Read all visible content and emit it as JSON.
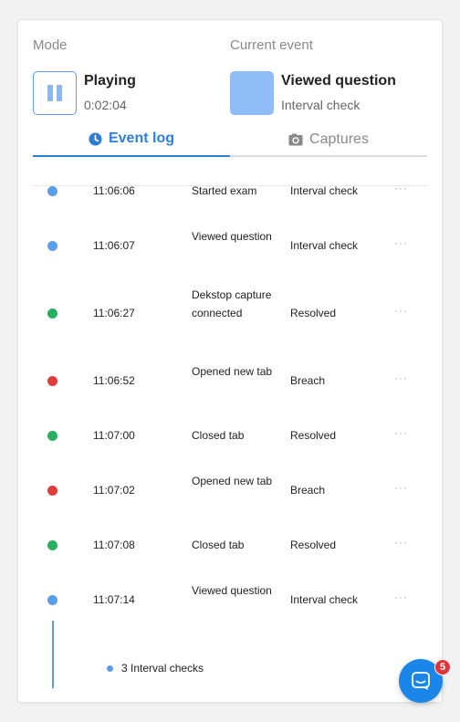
{
  "mode": {
    "label": "Mode",
    "state": "Playing",
    "elapsed": "0:02:04"
  },
  "current_event": {
    "label": "Current event",
    "title": "Viewed question",
    "subtitle": "Interval check",
    "swatch_color": "#8fbcf7"
  },
  "tabs": [
    {
      "label": "Event log",
      "icon": "clock-icon",
      "active": true
    },
    {
      "label": "Captures",
      "icon": "camera-icon",
      "active": false
    }
  ],
  "status_colors": {
    "blue": "#5b9ee9",
    "green": "#27ae60",
    "red": "#e03c3c"
  },
  "events": [
    {
      "time": "11:06:06",
      "description": "Started exam",
      "status": "Interval check",
      "color": "blue",
      "more": "···"
    },
    {
      "time": "11:06:07",
      "description": "Viewed question",
      "status": "Interval check",
      "color": "blue",
      "more": "···"
    },
    {
      "time": "11:06:27",
      "description": "Dekstop capture connected",
      "status": "Resolved",
      "color": "green",
      "more": "···"
    },
    {
      "time": "11:06:52",
      "description": "Opened new tab",
      "status": "Breach",
      "color": "red",
      "more": "···"
    },
    {
      "time": "11:07:00",
      "description": "Closed tab",
      "status": "Resolved",
      "color": "green",
      "more": "···"
    },
    {
      "time": "11:07:02",
      "description": "Opened new tab",
      "status": "Breach",
      "color": "red",
      "more": "···"
    },
    {
      "time": "11:07:08",
      "description": "Closed tab",
      "status": "Resolved",
      "color": "green",
      "more": "···"
    },
    {
      "time": "11:07:14",
      "description": "Viewed question",
      "status": "Interval check",
      "color": "blue",
      "more": "···"
    }
  ],
  "sub_item": {
    "label": "3 Interval checks"
  },
  "chat": {
    "badge_count": "5"
  }
}
